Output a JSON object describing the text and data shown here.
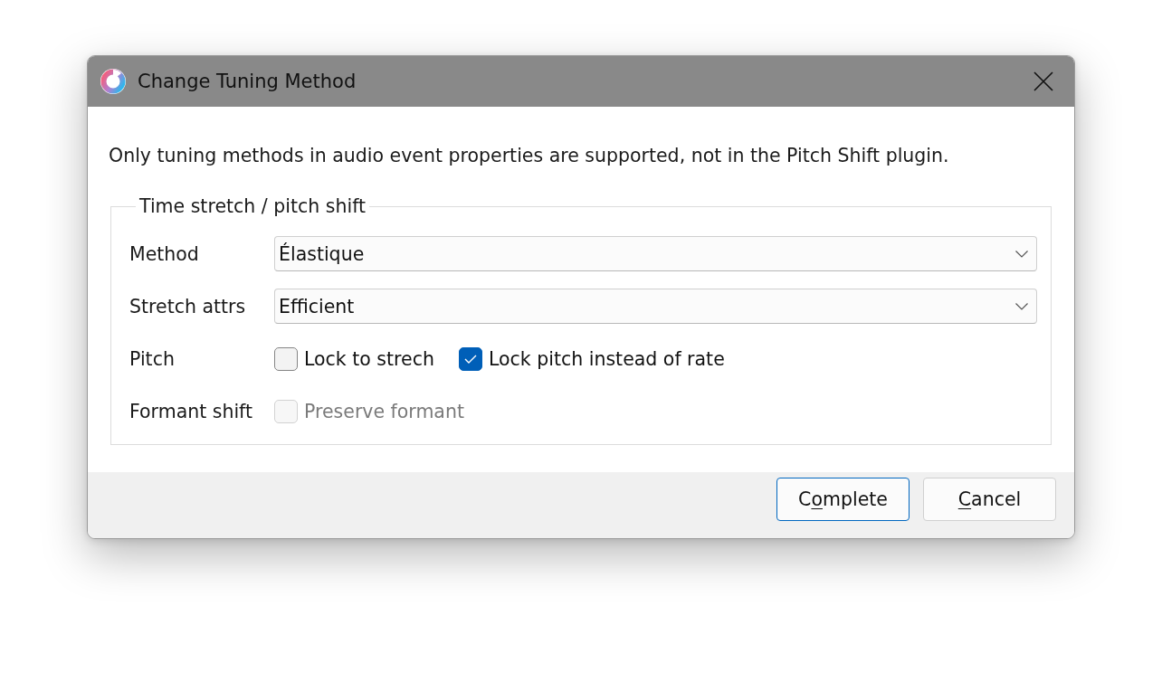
{
  "window": {
    "title": "Change Tuning Method"
  },
  "message": "Only tuning methods in audio event properties are supported, not in the Pitch Shift plugin.",
  "group": {
    "title": "Time stretch / pitch shift",
    "rows": [
      {
        "kind": "dropdown",
        "label": "Method",
        "value": "Élastique"
      },
      {
        "kind": "dropdown",
        "label": "Stretch attrs",
        "value": "Efficient"
      },
      {
        "kind": "checkboxes",
        "label": "Pitch",
        "options": [
          {
            "label": "Lock to strech",
            "checked": false,
            "disabled": false
          },
          {
            "label": "Lock pitch instead of rate",
            "checked": true,
            "disabled": false
          }
        ]
      },
      {
        "kind": "checkboxes",
        "label": "Formant shift",
        "options": [
          {
            "label": "Preserve formant",
            "checked": false,
            "disabled": true
          }
        ]
      }
    ]
  },
  "buttons": [
    {
      "text_before": "C",
      "access_key": "o",
      "text_after": "mplete",
      "default": true
    },
    {
      "access_key": "C",
      "text_after": "ancel",
      "default": false
    }
  ]
}
